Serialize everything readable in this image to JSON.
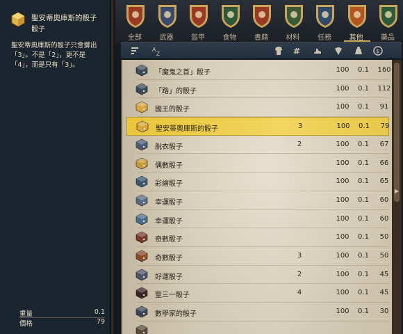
{
  "detail": {
    "title": "聖安蒂奧庫斯的骰子",
    "subtitle": "骰子",
    "description": "聖安蒂奧庫斯的骰子只會擲出「3」。不是「2」，更不是「4」，而是只有「3」。",
    "weight_label": "重量",
    "weight_value": "0.1",
    "price_label": "價格",
    "price_value": "79"
  },
  "categories": [
    {
      "label": "全部",
      "icon": "all-category-shield-icon",
      "color": "#9a3a22"
    },
    {
      "label": "武器",
      "icon": "weapons-shield-icon",
      "color": "#3a4a6a"
    },
    {
      "label": "盔甲",
      "icon": "armor-shield-icon",
      "color": "#9a3a22"
    },
    {
      "label": "食物",
      "icon": "food-shield-icon",
      "color": "#2f5a3a"
    },
    {
      "label": "書籍",
      "icon": "books-shield-icon",
      "color": "#9a3a22"
    },
    {
      "label": "材料",
      "icon": "materials-shield-icon",
      "color": "#3a5a3a"
    },
    {
      "label": "任務",
      "icon": "quest-shield-icon",
      "color": "#2f4a6a"
    },
    {
      "label": "其他",
      "icon": "misc-shield-icon",
      "color": "#b0561e",
      "active": true
    },
    {
      "label": "藥品",
      "icon": "potions-shield-icon",
      "color": "#2f5a3a"
    }
  ],
  "columns": {
    "sort_icon": "sort-icon",
    "name_sort_icon": "alphabetical-sort-icon",
    "type_icon": "type-icon",
    "quantity_icon": "quantity-hash-icon",
    "condition_icon": "condition-icon",
    "weight_icon": "weight-icon",
    "price_icon": "price-icon"
  },
  "items": [
    {
      "name": "「魔鬼之首」骰子",
      "qty": "",
      "cond": "100",
      "weight": "0.1",
      "price": "160",
      "die_color": "#3f4c5c"
    },
    {
      "name": "「路」的骰子",
      "qty": "",
      "cond": "100",
      "weight": "0.1",
      "price": "112",
      "die_color": "#3a4a5a"
    },
    {
      "name": "國王的骰子",
      "qty": "",
      "cond": "100",
      "weight": "0.1",
      "price": "91",
      "die_color": "#d8a63a"
    },
    {
      "name": "聖安蒂奧庫斯的骰子",
      "qty": "3",
      "cond": "100",
      "weight": "0.1",
      "price": "79",
      "die_color": "#d9a53c",
      "selected": true
    },
    {
      "name": "脫衣骰子",
      "qty": "2",
      "cond": "100",
      "weight": "0.1",
      "price": "67",
      "die_color": "#4a5a74"
    },
    {
      "name": "偶數骰子",
      "qty": "",
      "cond": "100",
      "weight": "0.1",
      "price": "66",
      "die_color": "#c8983a"
    },
    {
      "name": "彩繪骰子",
      "qty": "",
      "cond": "100",
      "weight": "0.1",
      "price": "65",
      "die_color": "#3a5870"
    },
    {
      "name": "幸運骰子",
      "qty": "",
      "cond": "100",
      "weight": "0.1",
      "price": "60",
      "die_color": "#5a6a84"
    },
    {
      "name": "幸運骰子",
      "qty": "",
      "cond": "100",
      "weight": "0.1",
      "price": "60",
      "die_color": "#4a6a8c"
    },
    {
      "name": "奇數骰子",
      "qty": "",
      "cond": "100",
      "weight": "0.1",
      "price": "50",
      "die_color": "#7a3a2a"
    },
    {
      "name": "奇數骰子",
      "qty": "3",
      "cond": "100",
      "weight": "0.1",
      "price": "50",
      "die_color": "#8a4a2a"
    },
    {
      "name": "好運骰子",
      "qty": "2",
      "cond": "100",
      "weight": "0.1",
      "price": "45",
      "die_color": "#4a5468"
    },
    {
      "name": "聖三一骰子",
      "qty": "4",
      "cond": "100",
      "weight": "0.1",
      "price": "45",
      "die_color": "#3a2424"
    },
    {
      "name": "數學家的骰子",
      "qty": "",
      "cond": "100",
      "weight": "0.1",
      "price": "30",
      "die_color": "#3a4656"
    },
    {
      "name": "",
      "qty": "",
      "cond": "",
      "weight": "",
      "price": "",
      "die_color": "#5a4a3a"
    }
  ]
}
